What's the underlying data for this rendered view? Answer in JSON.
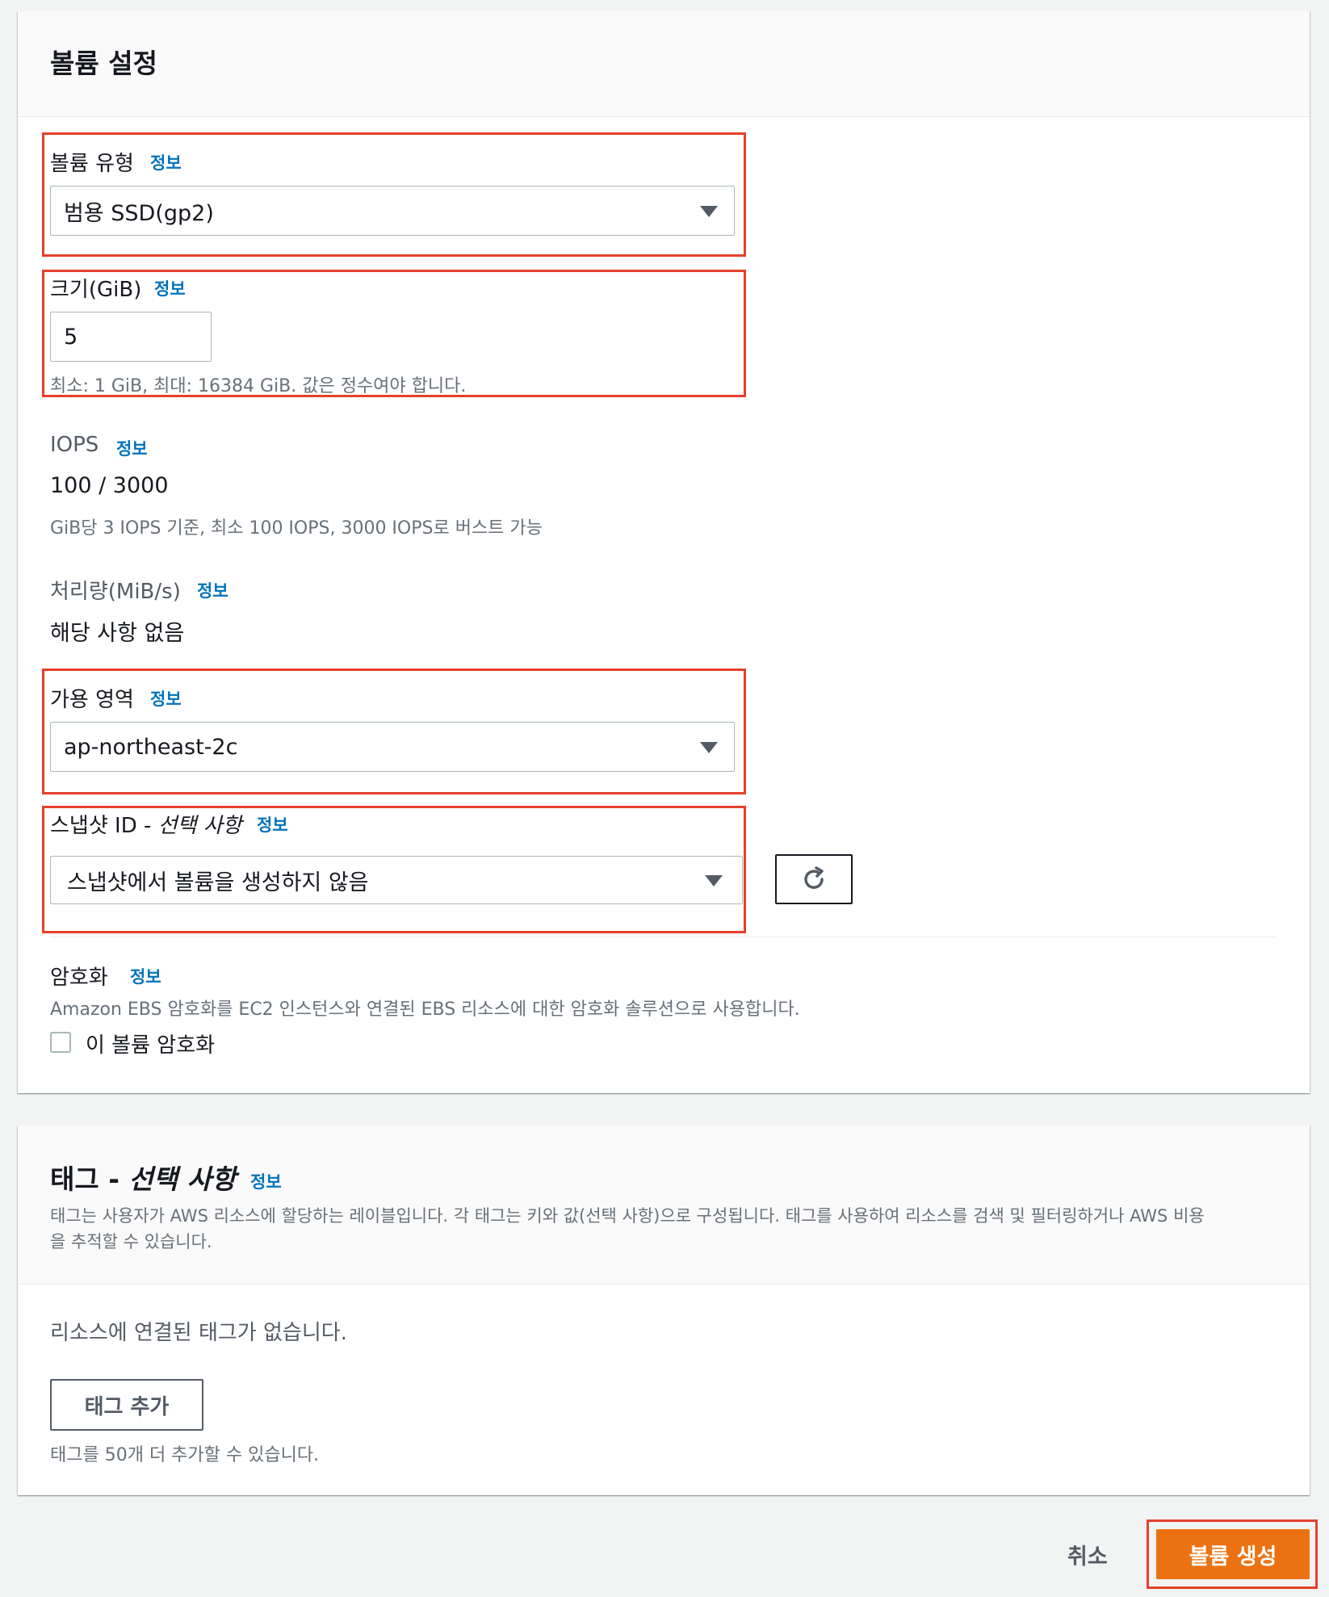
{
  "volume_settings": {
    "title": "볼륨 설정",
    "info_label": "정보",
    "volume_type": {
      "label": "볼륨 유형",
      "selected": "범용 SSD(gp2)"
    },
    "size": {
      "label": "크기(GiB)",
      "value": "5",
      "hint": "최소: 1 GiB, 최대: 16384 GiB. 값은 정수여야 합니다."
    },
    "iops": {
      "label": "IOPS",
      "value": "100 / 3000",
      "hint": "GiB당 3 IOPS 기준, 최소 100 IOPS, 3000 IOPS로 버스트 가능"
    },
    "throughput": {
      "label": "처리량(MiB/s)",
      "value": "해당 사항 없음"
    },
    "availability_zone": {
      "label": "가용 영역",
      "selected": "ap-northeast-2c"
    },
    "snapshot": {
      "label_main": "스냅샷 ID - ",
      "label_optional": "선택 사항",
      "selected": "스냅샷에서 볼륨을 생성하지 않음",
      "refresh_icon": "refresh-icon"
    },
    "encryption": {
      "label": "암호화",
      "hint": "Amazon EBS 암호화를 EC2 인스턴스와 연결된 EBS 리소스에 대한 암호화 솔루션으로 사용합니다.",
      "checkbox_label": "이 볼륨 암호화",
      "checked": false
    }
  },
  "tags": {
    "title_main": "태그 - ",
    "title_optional": "선택 사항",
    "info_label": "정보",
    "description_line1": "태그는 사용자가 AWS 리소스에 할당하는 레이블입니다. 각 태그는 키와 값(선택 사항)으로 구성됩니다. 태그를 사용하여 리소스를 검색 및 필터링하거나 AWS 비용",
    "description_line2": "을 추적할 수 있습니다.",
    "empty_text": "리소스에 연결된 태그가 없습니다.",
    "add_button": "태그 추가",
    "limit_hint": "태그를 50개 더 추가할 수 있습니다."
  },
  "footer": {
    "cancel": "취소",
    "create": "볼륨 생성"
  },
  "colors": {
    "primary": "#ec7211",
    "link": "#0073bb",
    "highlight": "#e4412b"
  }
}
